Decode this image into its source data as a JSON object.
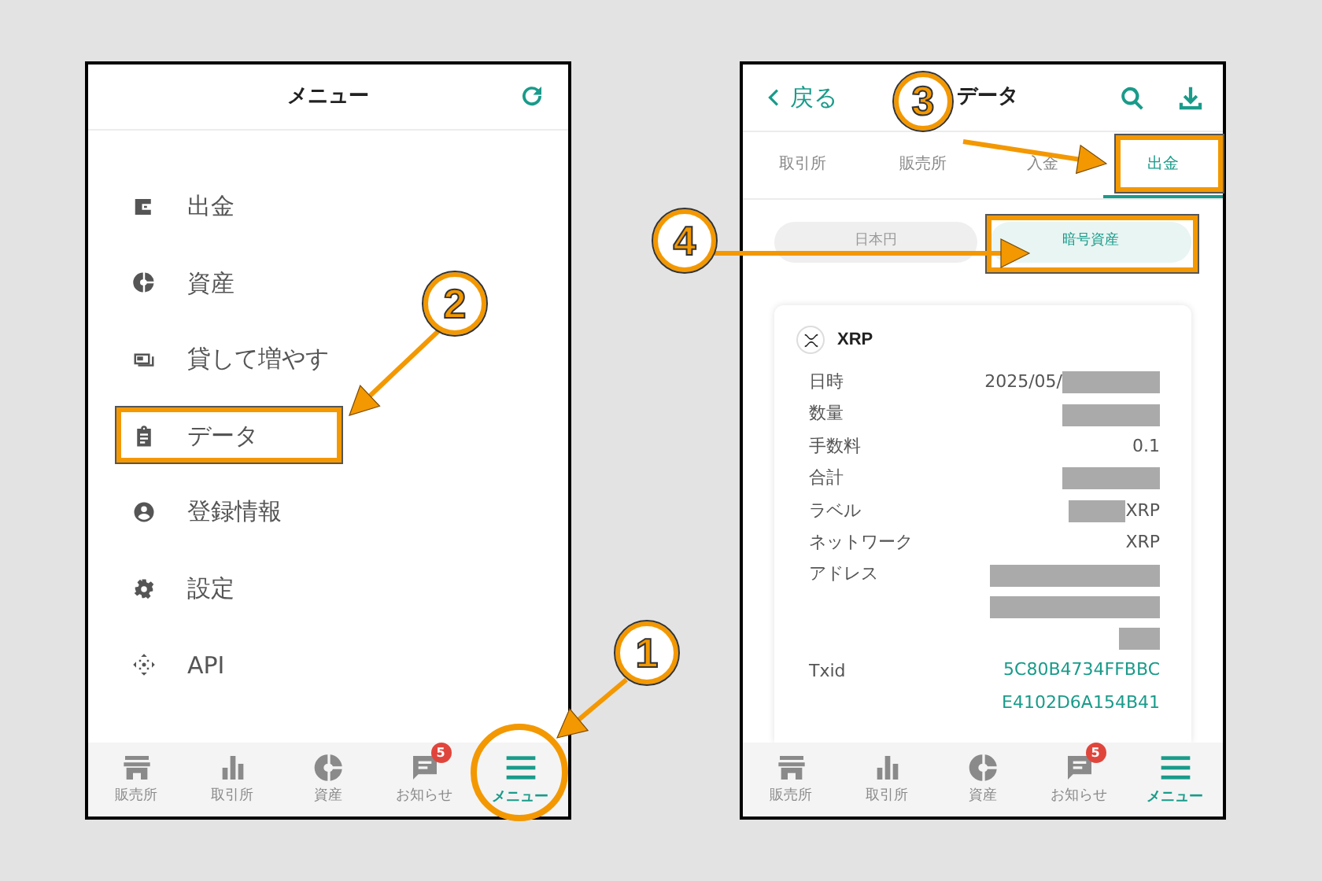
{
  "menu_screen": {
    "title": "メニュー",
    "items": [
      {
        "label": "出金"
      },
      {
        "label": "資産"
      },
      {
        "label": "貸して増やす"
      },
      {
        "label": "データ"
      },
      {
        "label": "登録情報"
      },
      {
        "label": "設定"
      },
      {
        "label": "API"
      }
    ],
    "nav": [
      {
        "label": "販売所",
        "selected": false
      },
      {
        "label": "取引所",
        "selected": false
      },
      {
        "label": "資産",
        "selected": false
      },
      {
        "label": "お知らせ",
        "selected": false,
        "badge": "5"
      },
      {
        "label": "メニュー",
        "selected": true
      }
    ]
  },
  "data_screen": {
    "back": "戻る",
    "title": "データ",
    "tabs": [
      {
        "label": "取引所",
        "selected": false
      },
      {
        "label": "販売所",
        "selected": false
      },
      {
        "label": "入金",
        "selected": false
      },
      {
        "label": "出金",
        "selected": true
      }
    ],
    "segments": [
      {
        "label": "日本円",
        "selected": false
      },
      {
        "label": "暗号資産",
        "selected": true
      }
    ],
    "card": {
      "coin": "XRP",
      "rows": [
        {
          "label": "日時",
          "lines": [
            [
              {
                "kind": "text",
                "text": "2025/05/"
              },
              {
                "kind": "mask"
              }
            ]
          ]
        },
        {
          "label": "数量",
          "lines": [
            [
              {
                "kind": "mask"
              }
            ]
          ]
        },
        {
          "label": "手数料",
          "lines": [
            [
              {
                "kind": "text",
                "text": "0.1"
              }
            ]
          ]
        },
        {
          "label": "合計",
          "lines": [
            [
              {
                "kind": "mask"
              }
            ]
          ]
        },
        {
          "label": "ラベル",
          "lines": [
            [
              {
                "kind": "mask"
              },
              {
                "kind": "text",
                "text": "XRP"
              }
            ]
          ]
        },
        {
          "label": "ネットワーク",
          "lines": [
            [
              {
                "kind": "text",
                "text": "XRP"
              }
            ]
          ]
        },
        {
          "label": "アドレス",
          "lines": [
            [
              {
                "kind": "mask"
              }
            ],
            [
              {
                "kind": "mask"
              }
            ],
            [
              {
                "kind": "mask"
              }
            ]
          ]
        },
        {
          "label": "Txid",
          "lines": [
            [
              {
                "kind": "link",
                "text": "5C80B4734FFBBC"
              }
            ],
            [
              {
                "kind": "link",
                "text": "E4102D6A154B41"
              }
            ]
          ]
        }
      ]
    },
    "nav": [
      {
        "label": "販売所",
        "selected": false
      },
      {
        "label": "取引所",
        "selected": false
      },
      {
        "label": "資産",
        "selected": false
      },
      {
        "label": "お知らせ",
        "selected": false,
        "badge": "5"
      },
      {
        "label": "メニュー",
        "selected": true
      }
    ]
  },
  "annotations": [
    {
      "number": "1"
    },
    {
      "number": "2"
    },
    {
      "number": "3"
    },
    {
      "number": "4"
    }
  ]
}
